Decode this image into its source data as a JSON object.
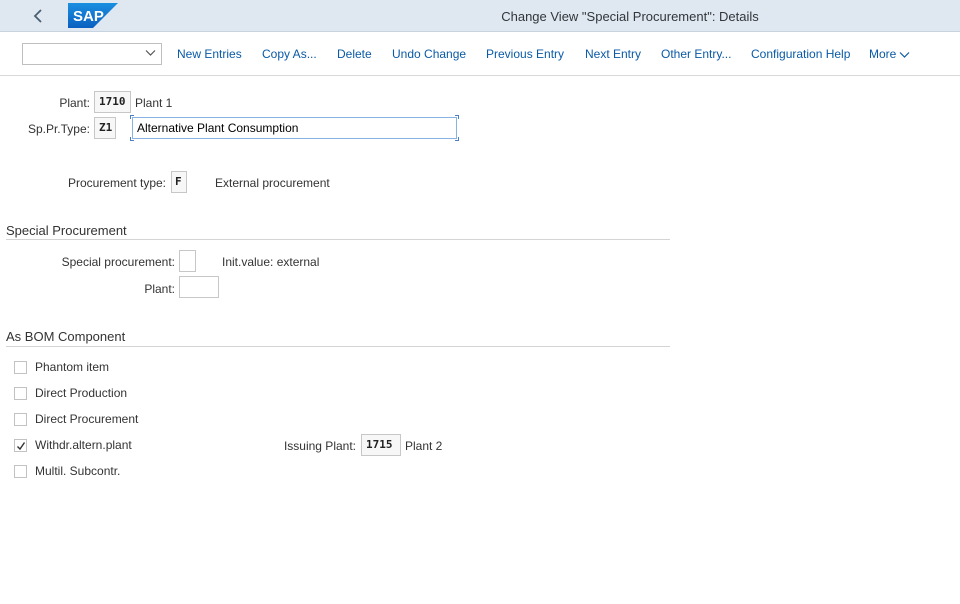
{
  "shell": {
    "logo_text": "SAP",
    "title": "Change View \"Special Procurement\": Details"
  },
  "toolbar": {
    "select_value": "",
    "buttons": [
      "New Entries",
      "Copy As...",
      "Delete",
      "Undo Change",
      "Previous Entry",
      "Next Entry",
      "Other Entry...",
      "Configuration Help",
      "More"
    ]
  },
  "header": {
    "plant_label": "Plant:",
    "plant_value": "1710",
    "plant_desc": "Plant 1",
    "sptype_label": "Sp.Pr.Type:",
    "sptype_value": "Z1",
    "sptype_desc": "Alternative Plant Consumption",
    "proc_label": "Procurement type:",
    "proc_value": "F",
    "proc_desc": "External procurement"
  },
  "special": {
    "title": "Special Procurement",
    "sp_label": "Special procurement:",
    "sp_value": "",
    "sp_desc": "Init.value: external",
    "plant_label": "Plant:",
    "plant_value": ""
  },
  "bom": {
    "title": "As BOM Component",
    "items": [
      {
        "label": "Phantom item",
        "checked": false
      },
      {
        "label": "Direct Production",
        "checked": false
      },
      {
        "label": "Direct Procurement",
        "checked": false
      },
      {
        "label": "Withdr.altern.plant",
        "checked": true
      },
      {
        "label": "Multil. Subcontr.",
        "checked": false
      }
    ],
    "issuing_label": "Issuing Plant:",
    "issuing_value": "1715",
    "issuing_desc": "Plant 2"
  },
  "colors": {
    "shell_bg": "#dfe8f1",
    "logo_blue": "#0a6ed1",
    "link_blue": "#0a5aa6"
  },
  "icons": {
    "back": "chevron-left-icon",
    "select": "chevron-down-icon",
    "more": "chevron-down-icon",
    "check": "checkmark-icon"
  }
}
